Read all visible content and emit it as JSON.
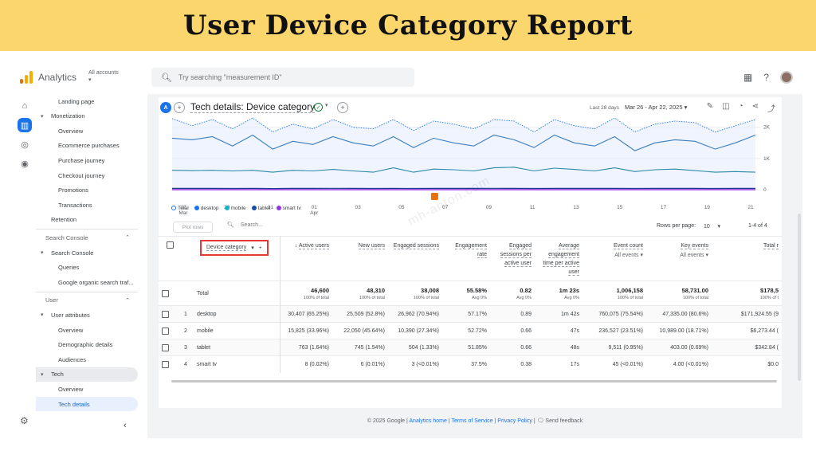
{
  "banner": {
    "title": "User Device Category Report"
  },
  "topbar": {
    "brand": "Analytics",
    "accounts_label": "All accounts",
    "search_placeholder": "Try searching \"measurement ID\""
  },
  "sidebar": {
    "items": [
      {
        "label": "Landing page",
        "level": 1,
        "top": 0
      },
      {
        "label": "Monetization",
        "level": 0,
        "expanded": true
      },
      {
        "label": "Overview",
        "level": 1
      },
      {
        "label": "Ecommerce purchases",
        "level": 1
      },
      {
        "label": "Purchase journey",
        "level": 1
      },
      {
        "label": "Checkout journey",
        "level": 1
      },
      {
        "label": "Promotions",
        "level": 1
      },
      {
        "label": "Transactions",
        "level": 1
      },
      {
        "label": "Retention",
        "level": 0
      }
    ],
    "search_console_section": "Search Console",
    "search_console_items": [
      {
        "label": "Search Console",
        "level": 0,
        "expanded": true
      },
      {
        "label": "Queries",
        "level": 1
      },
      {
        "label": "Google organic search traf...",
        "level": 1
      }
    ],
    "user_section": "User",
    "user_items": [
      {
        "label": "User attributes",
        "level": 0,
        "expanded": true
      },
      {
        "label": "Overview",
        "level": 1
      },
      {
        "label": "Demographic details",
        "level": 1
      },
      {
        "label": "Audiences",
        "level": 1
      },
      {
        "label": "Tech",
        "level": 0,
        "expanded": true
      },
      {
        "label": "Overview",
        "level": 1
      },
      {
        "label": "Tech details",
        "level": 1,
        "selected": true
      }
    ]
  },
  "report": {
    "avatar_letter": "A",
    "title": "Tech details: Device category",
    "date_label": "Last 28 days",
    "date_range": "Mar 26 - Apr 22, 2025"
  },
  "chart_data": {
    "type": "line",
    "x": [
      "27 Mar",
      "29",
      "31",
      "01 Apr",
      "03",
      "05",
      "07",
      "09",
      "11",
      "13",
      "15",
      "17",
      "19",
      "21"
    ],
    "x_tick_top": [
      "27",
      "29",
      "31",
      "01",
      "03",
      "05",
      "07",
      "09",
      "11",
      "13",
      "15",
      "17",
      "19",
      "21"
    ],
    "x_tick_bottom": [
      "Mar",
      "",
      "",
      "Apr",
      "",
      "",
      "",
      "",
      "",
      "",
      "",
      "",
      "",
      ""
    ],
    "y_ticks": [
      "2K",
      "1K",
      "0"
    ],
    "ylim": [
      0,
      2300
    ],
    "legend": [
      "Total",
      "desktop",
      "mobile",
      "tablet",
      "smart tv"
    ],
    "colors": {
      "Total": "#1a73e8",
      "desktop": "#1a73e8",
      "mobile": "#12b5cb",
      "tablet": "#174ea6",
      "smart tv": "#9334e6"
    },
    "series": [
      {
        "name": "Total",
        "values": [
          2280,
          2050,
          2250,
          1950,
          2300,
          1850,
          2100,
          1950,
          2250,
          2000,
          1950,
          2250,
          1900,
          2200,
          2100,
          1950,
          2250,
          2200,
          1850,
          2250,
          2050,
          1950,
          2300,
          1850,
          2100,
          2200,
          2150,
          1850,
          2050,
          2250
        ]
      },
      {
        "name": "desktop",
        "values": [
          1650,
          1600,
          1700,
          1400,
          1750,
          1300,
          1550,
          1450,
          1700,
          1500,
          1400,
          1700,
          1350,
          1650,
          1500,
          1400,
          1750,
          1600,
          1350,
          1750,
          1500,
          1400,
          1700,
          1250,
          1500,
          1600,
          1550,
          1300,
          1500,
          1750
        ]
      },
      {
        "name": "mobile",
        "values": [
          620,
          610,
          620,
          600,
          620,
          560,
          620,
          600,
          650,
          600,
          560,
          700,
          560,
          660,
          640,
          600,
          700,
          720,
          600,
          690,
          650,
          600,
          700,
          580,
          640,
          660,
          610,
          560,
          580,
          560
        ]
      },
      {
        "name": "tablet",
        "values": [
          40,
          40,
          42,
          38,
          40,
          36,
          40,
          40,
          44,
          40,
          38,
          42,
          38,
          42,
          40,
          40,
          44,
          42,
          38,
          42,
          40,
          40,
          42,
          38,
          40,
          42,
          40,
          38,
          40,
          42
        ]
      },
      {
        "name": "smart tv",
        "values": [
          1,
          1,
          1,
          1,
          1,
          1,
          1,
          1,
          1,
          1,
          1,
          1,
          1,
          1,
          1,
          1,
          1,
          1,
          1,
          1,
          1,
          1,
          1,
          1,
          1,
          1,
          1,
          1,
          1,
          1
        ]
      }
    ]
  },
  "toolbar": {
    "plot_rows": "Plot rows",
    "search_placeholder": "Search...",
    "rows_per_page_label": "Rows per page:",
    "rows_per_page_value": "10",
    "pagination": "1-4 of 4"
  },
  "watermark": "mh-anton.com",
  "table": {
    "dimension_label": "Device category",
    "columns": [
      {
        "label": "Active users",
        "sort": "↓",
        "total": "46,600",
        "total_sub": "100% of total"
      },
      {
        "label": "New users",
        "total": "48,310",
        "total_sub": "100% of total"
      },
      {
        "label": "Engaged sessions",
        "total": "38,008",
        "total_sub": "100% of total"
      },
      {
        "label": "Engagement rate",
        "total": "55.58%",
        "total_sub": "Avg 0%"
      },
      {
        "label": "Engaged sessions per active user",
        "total": "0.82",
        "total_sub": "Avg 0%"
      },
      {
        "label": "Average engagement time per active user",
        "total": "1m 23s",
        "total_sub": "Avg 0%"
      },
      {
        "label": "Event count",
        "sub": "All events ▾",
        "total": "1,006,158",
        "total_sub": "100% of total"
      },
      {
        "label": "Key events",
        "sub": "All events ▾",
        "total": "58,731.00",
        "total_sub": "100% of total"
      },
      {
        "label": "Total r",
        "total": "$178,5",
        "total_sub": "100% of t"
      }
    ],
    "total_label": "Total",
    "rows": [
      {
        "n": "1",
        "name": "desktop",
        "cells": [
          "30,407 (65.25%)",
          "25,509 (52.8%)",
          "26,962 (70.94%)",
          "57.17%",
          "0.89",
          "1m 42s",
          "760,075 (75.54%)",
          "47,335.00 (80.6%)",
          "$171,924.55 (9"
        ]
      },
      {
        "n": "2",
        "name": "mobile",
        "cells": [
          "15,825 (33.96%)",
          "22,050 (45.64%)",
          "10,390 (27.34%)",
          "52.72%",
          "0.66",
          "47s",
          "236,527 (23.51%)",
          "10,989.00 (18.71%)",
          "$6,273.44 ("
        ]
      },
      {
        "n": "3",
        "name": "tablet",
        "cells": [
          "763 (1.64%)",
          "745 (1.54%)",
          "504 (1.33%)",
          "51.85%",
          "0.66",
          "48s",
          "9,511 (0.95%)",
          "403.00 (0.69%)",
          "$342.84 ("
        ]
      },
      {
        "n": "4",
        "name": "smart tv",
        "cells": [
          "8 (0.02%)",
          "6 (0.01%)",
          "3 (<0.01%)",
          "37.5%",
          "0.38",
          "17s",
          "45 (<0.01%)",
          "4.00 (<0.01%)",
          "$0.0"
        ]
      }
    ]
  },
  "footer": {
    "copyright": "© 2025 Google |",
    "links": [
      "Analytics home",
      "Terms of Service",
      "Privacy Policy"
    ],
    "feedback": "Send feedback"
  },
  "icons": [
    "apps-icon",
    "help-icon",
    "home-icon",
    "reports-icon",
    "explore-icon",
    "advertising-icon",
    "settings-icon",
    "share-icon",
    "insights-icon"
  ]
}
